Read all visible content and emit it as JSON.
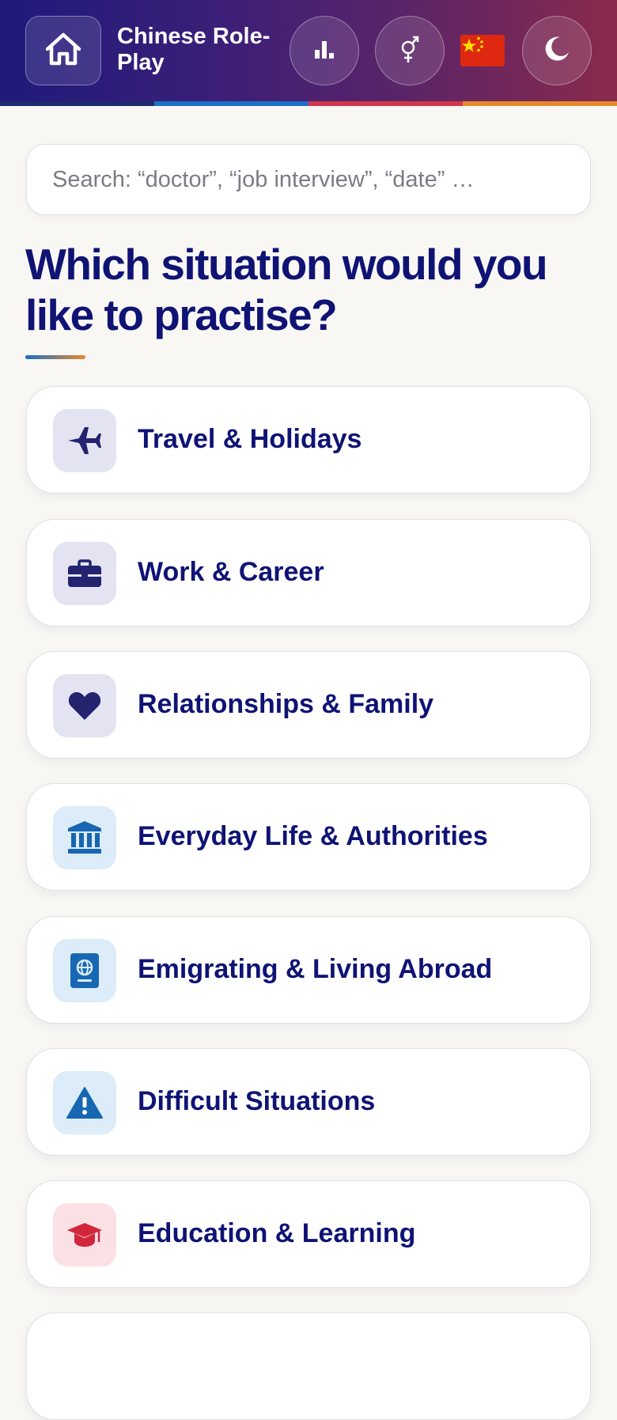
{
  "header": {
    "title": "Chinese Role-Play",
    "home_icon": "home-icon",
    "stats_icon": "bar-chart-icon",
    "gender_icon": "gender-icon",
    "language_flag": "china-flag-icon",
    "theme_icon": "moon-icon",
    "stripe_colors": [
      "#1f2a6e",
      "#1b70c4",
      "#d2364a",
      "#e58a2c"
    ]
  },
  "search": {
    "placeholder": "Search: “doctor”, “job interview”, “date” …",
    "value": ""
  },
  "main": {
    "heading": "Which situation would you like to practise?",
    "categories": [
      {
        "label": "Travel & Holidays",
        "icon": "airplane-icon",
        "icon_color": "#23236f",
        "icon_bg": "#e4e3f1"
      },
      {
        "label": "Work & Career",
        "icon": "briefcase-icon",
        "icon_color": "#23236f",
        "icon_bg": "#e4e3f1"
      },
      {
        "label": "Relationships & Family",
        "icon": "heart-icon",
        "icon_color": "#23236f",
        "icon_bg": "#e4e3f1"
      },
      {
        "label": "Everyday Life & Authorities",
        "icon": "landmark-icon",
        "icon_color": "#1767b3",
        "icon_bg": "#dcecf8"
      },
      {
        "label": "Emigrating & Living Abroad",
        "icon": "passport-icon",
        "icon_color": "#1767b3",
        "icon_bg": "#dcecf8"
      },
      {
        "label": "Difficult Situations",
        "icon": "warning-icon",
        "icon_color": "#1767b3",
        "icon_bg": "#dcecf8"
      },
      {
        "label": "Education & Learning",
        "icon": "graduation-cap-icon",
        "icon_color": "#d2263c",
        "icon_bg": "#fbe1e5"
      }
    ]
  }
}
